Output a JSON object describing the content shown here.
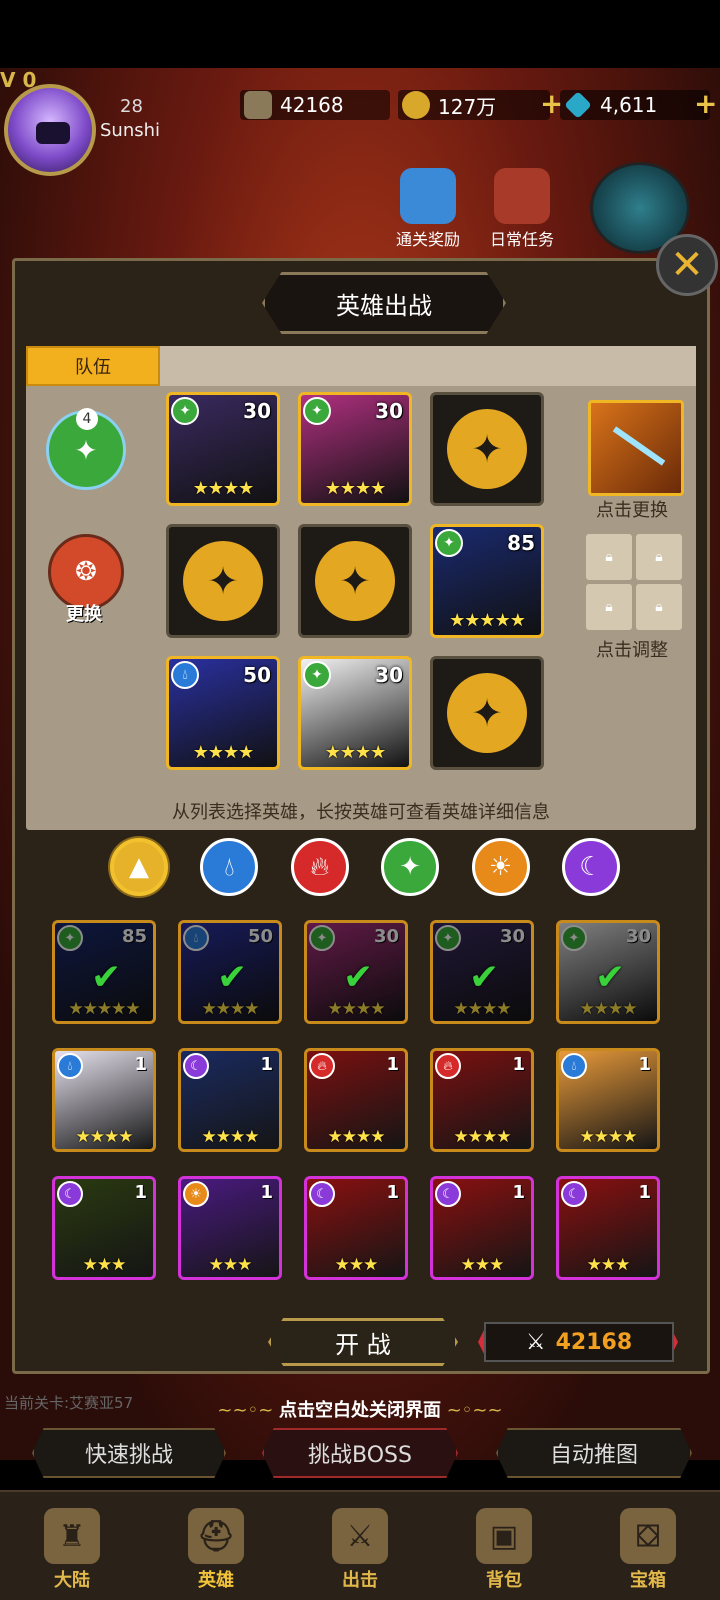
{
  "player": {
    "vip": "V 0",
    "level": "28",
    "name": "Sunshi"
  },
  "resources": {
    "power": "42168",
    "gold": "127万",
    "gems": "4,611"
  },
  "events": [
    {
      "label": "通关奖励"
    },
    {
      "label": "日常任务"
    }
  ],
  "panel": {
    "title": "英雄出战",
    "tab": "队伍",
    "formation_count": "4",
    "swap_label": "更换",
    "weapon_hint": "点击更换",
    "adjust_hint": "点击调整",
    "hint": "从列表选择英雄，长按英雄可查看英雄详细信息"
  },
  "team_slots": [
    {
      "type": "hero",
      "level": "30",
      "stars": "★★★★",
      "element": "wind",
      "art": "#3a2a60"
    },
    {
      "type": "hero",
      "level": "30",
      "stars": "★★★★",
      "element": "wind",
      "art": "#b03080"
    },
    {
      "type": "empty"
    },
    {
      "type": "empty"
    },
    {
      "type": "empty"
    },
    {
      "type": "hero",
      "level": "85",
      "stars": "★★★★★",
      "element": "wind",
      "art": "#1a2a70"
    },
    {
      "type": "hero",
      "level": "50",
      "stars": "★★★★",
      "element": "water",
      "art": "#2a30a0"
    },
    {
      "type": "hero",
      "level": "30",
      "stars": "★★★★",
      "element": "wind",
      "art": "#f2f2f2"
    },
    {
      "type": "empty"
    }
  ],
  "filters": [
    {
      "name": "all",
      "active": true
    },
    {
      "name": "water"
    },
    {
      "name": "fire"
    },
    {
      "name": "wind"
    },
    {
      "name": "light"
    },
    {
      "name": "dark"
    }
  ],
  "roster": [
    {
      "level": "85",
      "stars": "★★★★★",
      "element": "wind",
      "selected": true,
      "art": "#1a2a70"
    },
    {
      "level": "50",
      "stars": "★★★★",
      "element": "water",
      "selected": true,
      "art": "#2a30a0"
    },
    {
      "level": "30",
      "stars": "★★★★",
      "element": "wind",
      "selected": true,
      "art": "#b03080"
    },
    {
      "level": "30",
      "stars": "★★★★",
      "element": "wind",
      "selected": true,
      "art": "#3a2a60"
    },
    {
      "level": "30",
      "stars": "★★★★",
      "element": "wind",
      "selected": true,
      "art": "#e8e8e8"
    },
    {
      "level": "1",
      "stars": "★★★★",
      "element": "water",
      "art": "#e6e2ee"
    },
    {
      "level": "1",
      "stars": "★★★★",
      "element": "dark",
      "art": "#1a2a60"
    },
    {
      "level": "1",
      "stars": "★★★★",
      "element": "fire",
      "art": "#7a1010"
    },
    {
      "level": "1",
      "stars": "★★★★",
      "element": "fire",
      "art": "#7a1010"
    },
    {
      "level": "1",
      "stars": "★★★★",
      "element": "water",
      "art": "#e89a3a"
    },
    {
      "level": "1",
      "stars": "★★★",
      "element": "dark",
      "border": "purple",
      "art": "#2a3a10"
    },
    {
      "level": "1",
      "stars": "★★★",
      "element": "light",
      "border": "purple",
      "art": "#4a1a80"
    },
    {
      "level": "1",
      "stars": "★★★",
      "element": "dark",
      "border": "purple",
      "art": "#8a1010"
    },
    {
      "level": "1",
      "stars": "★★★",
      "element": "dark",
      "border": "purple",
      "art": "#8a1010"
    },
    {
      "level": "1",
      "stars": "★★★",
      "element": "dark",
      "border": "purple",
      "art": "#8a1010"
    }
  ],
  "battle": {
    "start_label": "开 战",
    "power": "42168"
  },
  "stage": {
    "label": "当前关卡:艾赛亚57"
  },
  "close_hint": "点击空白处关闭界面",
  "actions": [
    {
      "label": "快速挑战"
    },
    {
      "label": "挑战BOSS"
    },
    {
      "label": "自动推图"
    }
  ],
  "nav": [
    {
      "label": "大陆",
      "icon": "castle-icon"
    },
    {
      "label": "英雄",
      "icon": "helmet-icon"
    },
    {
      "label": "出击",
      "icon": "swords-icon"
    },
    {
      "label": "背包",
      "icon": "backpack-icon"
    },
    {
      "label": "宝箱",
      "icon": "chest-icon"
    }
  ],
  "colors": {
    "gold": "#f1b623",
    "purple": "#d232d8",
    "wind": "#3aa83a",
    "water": "#2a7ad8",
    "fire": "#d62a2a",
    "light": "#e88a1a",
    "dark": "#8a3ad8",
    "all": "#e6b22a"
  }
}
